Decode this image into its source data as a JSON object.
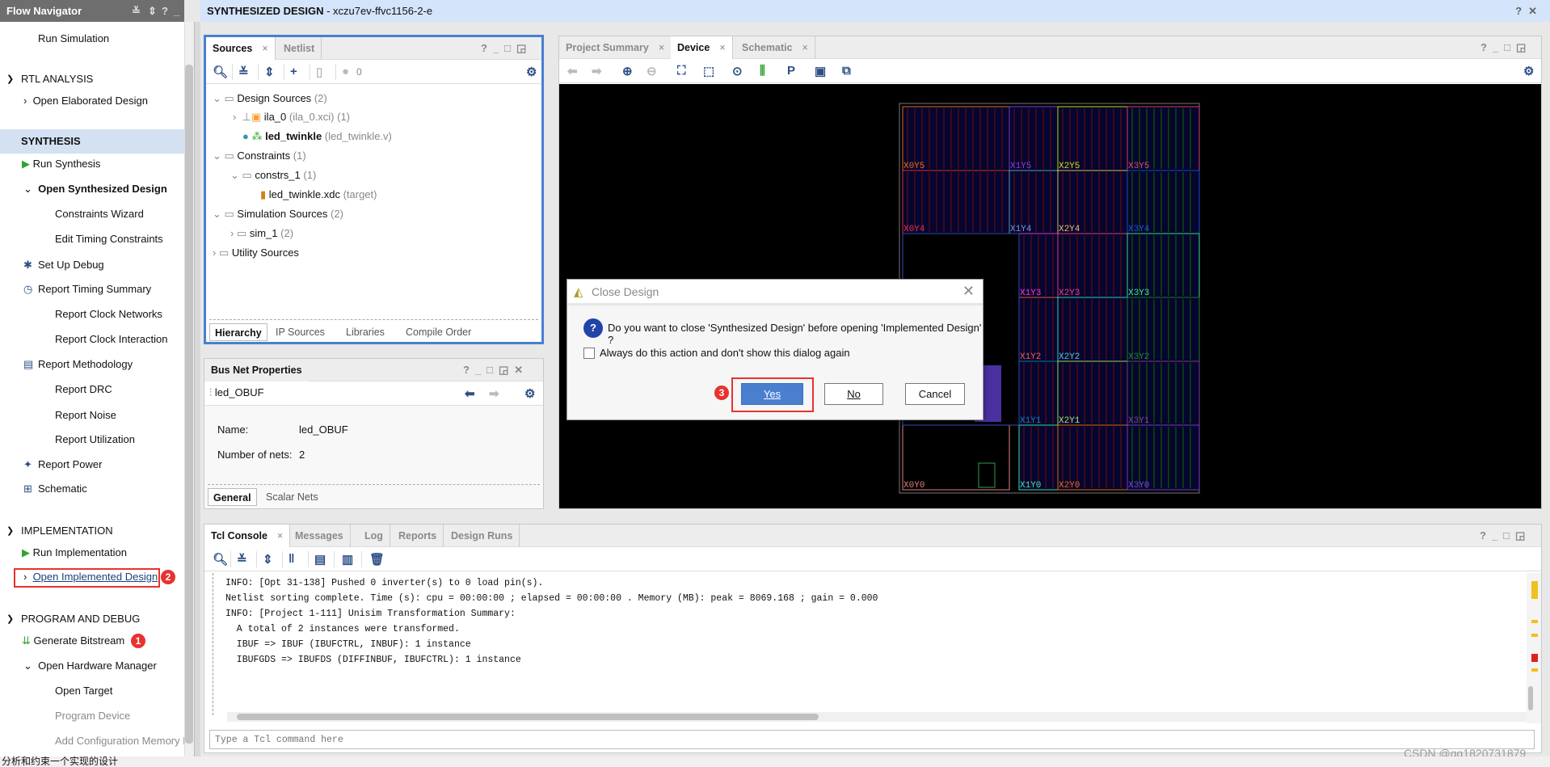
{
  "flow_navigator": {
    "title": "Flow Navigator",
    "items": {
      "run_simulation": "Run Simulation",
      "rtl": "RTL ANALYSIS",
      "open_elab": "Open Elaborated Design",
      "synthesis": "SYNTHESIS",
      "run_synth": "Run Synthesis",
      "open_synth": "Open Synthesized Design",
      "constraints_wizard": "Constraints Wizard",
      "edit_timing": "Edit Timing Constraints",
      "setup_debug": "Set Up Debug",
      "report_timing": "Report Timing Summary",
      "report_clock_net": "Report Clock Networks",
      "report_clock_int": "Report Clock Interaction",
      "report_method": "Report Methodology",
      "report_drc": "Report DRC",
      "report_noise": "Report Noise",
      "report_util": "Report Utilization",
      "report_power": "Report Power",
      "schematic": "Schematic",
      "implementation": "IMPLEMENTATION",
      "run_impl": "Run Implementation",
      "open_impl": "Open Implemented Design",
      "prog_debug": "PROGRAM AND DEBUG",
      "gen_bit": "Generate Bitstream",
      "open_hw": "Open Hardware Manager",
      "open_target": "Open Target",
      "program_device": "Program Device",
      "add_cfg": "Add Configuration Memory De"
    }
  },
  "title_bar": {
    "title": "SYNTHESIZED DESIGN",
    "part": " - xczu7ev-ffvc1156-2-e"
  },
  "sources": {
    "tabs": [
      "Sources",
      "Netlist"
    ],
    "count": "0",
    "tree": {
      "design_sources": "Design Sources",
      "design_sources_n": "(2)",
      "ila": "ila_0",
      "ila_file": "(ila_0.xci) (1)",
      "led": "led_twinkle",
      "led_file": "(led_twinkle.v)",
      "constraints": "Constraints",
      "constraints_n": "(1)",
      "constrs": "constrs_1",
      "constrs_n": "(1)",
      "xdc": "led_twinkle.xdc",
      "xdc_t": "(target)",
      "sim": "Simulation Sources",
      "sim_n": "(2)",
      "sim1": "sim_1",
      "sim1_n": "(2)",
      "util": "Utility Sources"
    },
    "bottom_tabs": [
      "Hierarchy",
      "IP Sources",
      "Libraries",
      "Compile Order"
    ]
  },
  "bus_net": {
    "title": "Bus Net Properties",
    "net": "led_OBUF",
    "name_label": "Name:",
    "name_value": "led_OBUF",
    "nets_label": "Number of nets:",
    "nets_value": "2",
    "tabs": [
      "General",
      "Scalar Nets"
    ]
  },
  "device": {
    "tabs": [
      "Project Summary",
      "Device",
      "Schematic"
    ],
    "regions": [
      "X0Y5",
      "X1Y5",
      "X2Y5",
      "X3Y5",
      "X0Y4",
      "X1Y4",
      "X2Y4",
      "X3Y4",
      "X1Y3",
      "X2Y3",
      "X3Y3",
      "X1Y2",
      "X2Y2",
      "X3Y2",
      "X1Y1",
      "X2Y1",
      "X3Y1",
      "X0Y0",
      "X1Y0",
      "X2Y0",
      "X3Y0"
    ]
  },
  "console": {
    "tabs": [
      "Tcl Console",
      "Messages",
      "Log",
      "Reports",
      "Design Runs"
    ],
    "lines": [
      "INFO: [Opt 31-138] Pushed 0 inverter(s) to 0 load pin(s).",
      "Netlist sorting complete. Time (s): cpu = 00:00:00 ; elapsed = 00:00:00 . Memory (MB): peak = 8069.168 ; gain = 0.000",
      "INFO: [Project 1-111] Unisim Transformation Summary:",
      "  A total of 2 instances were transformed.",
      "  IBUF => IBUF (IBUFCTRL, INBUF): 1 instance",
      "  IBUFGDS => IBUFDS (DIFFINBUF, IBUFCTRL): 1 instance"
    ],
    "placeholder": "Type a Tcl command here"
  },
  "dialog": {
    "title": "Close Design",
    "message": "Do you want to close 'Synthesized Design' before opening 'Implemented Design' ?",
    "checkbox": "Always do this action and don't show this dialog again",
    "checked": false,
    "yes": "Yes",
    "no": "No",
    "cancel": "Cancel"
  },
  "annotations": [
    "1",
    "2",
    "3"
  ],
  "status_bar": "分析和约束一个实现的设计",
  "watermark": "CSDN @qq1820731879",
  "colors": {
    "accent": "#4a7fd0",
    "selection": "#d3e1f3",
    "annotation": "#e8322f",
    "primary_button": "#4a7fd0"
  }
}
